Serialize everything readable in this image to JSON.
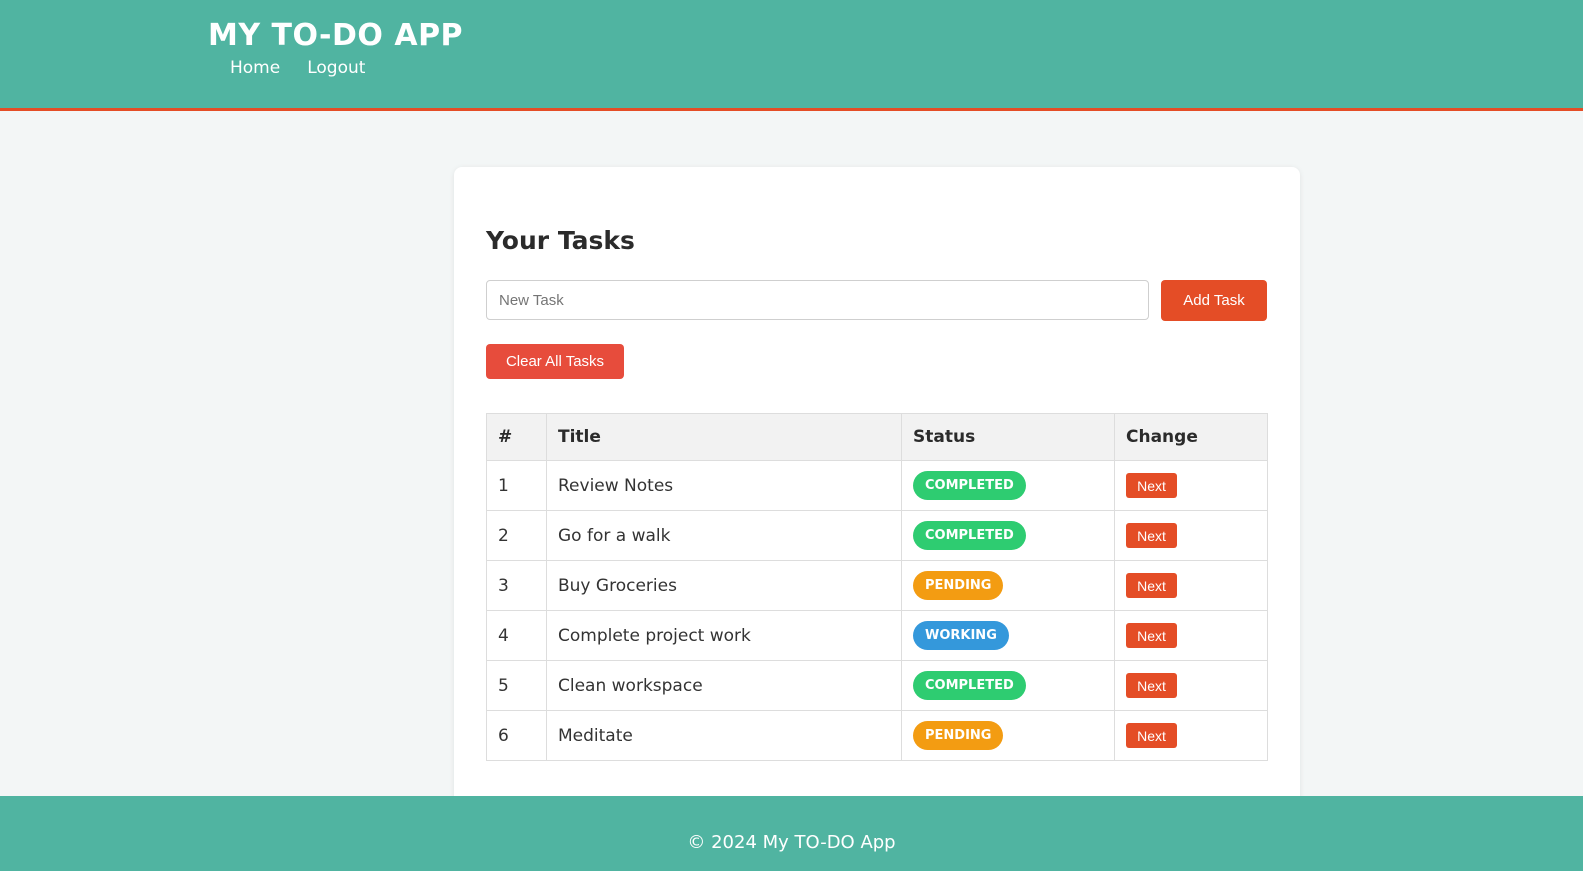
{
  "header": {
    "title": "MY TO-DO APP",
    "nav": [
      {
        "label": "Home"
      },
      {
        "label": "Logout"
      }
    ]
  },
  "main": {
    "title": "Your Tasks",
    "new_task_placeholder": "New Task",
    "new_task_value": "",
    "add_button": "Add Task",
    "clear_button": "Clear All Tasks",
    "table": {
      "columns": [
        "#",
        "Title",
        "Status",
        "Change"
      ],
      "rows": [
        {
          "num": "1",
          "title": "Review Notes",
          "status": "COMPLETED",
          "action": "Next"
        },
        {
          "num": "2",
          "title": "Go for a walk",
          "status": "COMPLETED",
          "action": "Next"
        },
        {
          "num": "3",
          "title": "Buy Groceries",
          "status": "PENDING",
          "action": "Next"
        },
        {
          "num": "4",
          "title": "Complete project work",
          "status": "WORKING",
          "action": "Next"
        },
        {
          "num": "5",
          "title": "Clean workspace",
          "status": "COMPLETED",
          "action": "Next"
        },
        {
          "num": "6",
          "title": "Meditate",
          "status": "PENDING",
          "action": "Next"
        }
      ]
    }
  },
  "footer": {
    "text": "© 2024 My TO-DO App"
  },
  "colors": {
    "brand": "#50b4a1",
    "accent": "#e44d26",
    "danger": "#e74c3c",
    "status_completed": "#2ecc71",
    "status_pending": "#f39c12",
    "status_working": "#3498db"
  }
}
